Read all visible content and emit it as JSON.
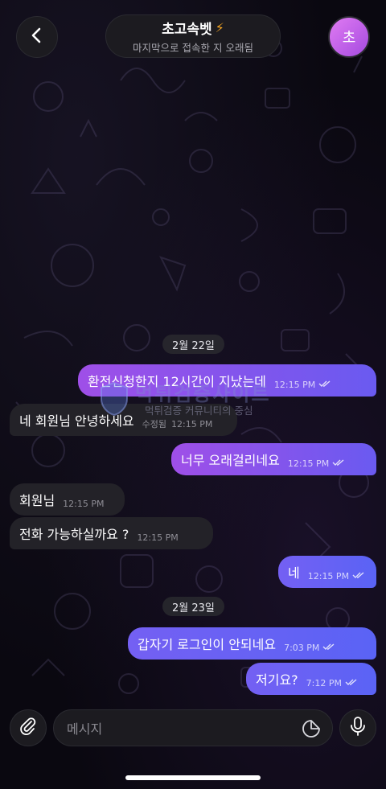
{
  "header": {
    "back_label": "",
    "title": "초고속벳",
    "title_emoji": "⚡",
    "subtitle": "마지막으로 접속한 지 오래됨",
    "avatar_initial": "초"
  },
  "messages": {
    "date1": "2월 22일",
    "m1": {
      "text": "환전신청한지 12시간이 지났는데",
      "time": "12:15 PM"
    },
    "m2": {
      "text": "네 회원님 안녕하세요",
      "edited": "수정됨",
      "time": "12:15 PM"
    },
    "m3": {
      "text": "너무 오래걸리네요",
      "time": "12:15 PM"
    },
    "m4": {
      "text": "회원님",
      "time": "12:15 PM"
    },
    "m5": {
      "text": "전화 가능하실까요 ?",
      "time": "12:15 PM"
    },
    "m6": {
      "text": "네",
      "time": "12:15 PM"
    },
    "date2": "2월 23일",
    "m7": {
      "text": "갑자기 로그인이 안되네요",
      "time": "7:03 PM"
    },
    "m8": {
      "text": "저기요?",
      "time": "7:12 PM"
    }
  },
  "watermark": {
    "main": "먹튀검증사이트",
    "sub": "먹튀검증 커뮤니티의 중심"
  },
  "composer": {
    "placeholder": "메시지"
  },
  "colors": {
    "outgoing_start": "#9f4fe8",
    "outgoing_end": "#6a5af0",
    "incoming": "#232228",
    "background": "#0b0910"
  }
}
